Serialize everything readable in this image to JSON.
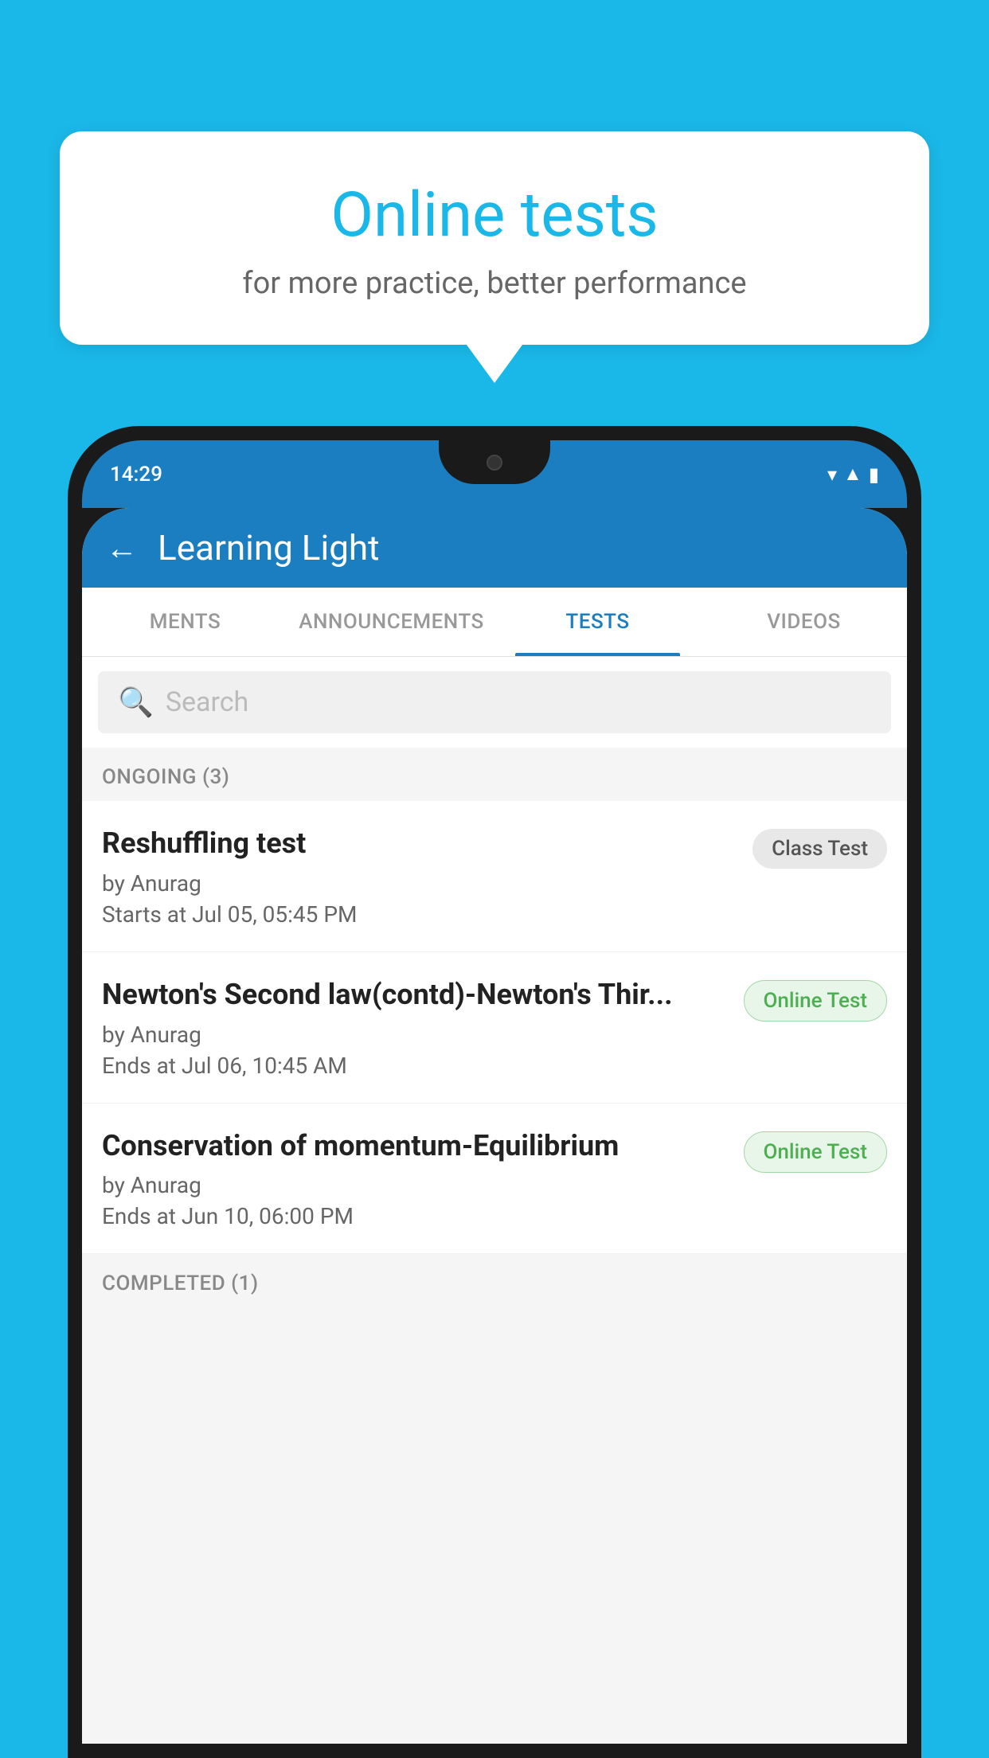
{
  "background": {
    "color": "#1ab8e8"
  },
  "speech_bubble": {
    "title": "Online tests",
    "subtitle": "for more practice, better performance"
  },
  "phone": {
    "status_bar": {
      "time": "14:29"
    },
    "app_bar": {
      "title": "Learning Light",
      "back_label": "←"
    },
    "tabs": [
      {
        "label": "MENTS",
        "active": false
      },
      {
        "label": "ANNOUNCEMENTS",
        "active": false
      },
      {
        "label": "TESTS",
        "active": true
      },
      {
        "label": "VIDEOS",
        "active": false
      }
    ],
    "search": {
      "placeholder": "Search"
    },
    "sections": [
      {
        "header": "ONGOING (3)",
        "items": [
          {
            "name": "Reshuffling test",
            "author": "by Anurag",
            "time_label": "Starts at",
            "time": "Jul 05, 05:45 PM",
            "badge": "Class Test",
            "badge_type": "class"
          },
          {
            "name": "Newton's Second law(contd)-Newton's Thir...",
            "author": "by Anurag",
            "time_label": "Ends at",
            "time": "Jul 06, 10:45 AM",
            "badge": "Online Test",
            "badge_type": "online"
          },
          {
            "name": "Conservation of momentum-Equilibrium",
            "author": "by Anurag",
            "time_label": "Ends at",
            "time": "Jun 10, 06:00 PM",
            "badge": "Online Test",
            "badge_type": "online"
          }
        ]
      }
    ],
    "completed_header": "COMPLETED (1)"
  }
}
